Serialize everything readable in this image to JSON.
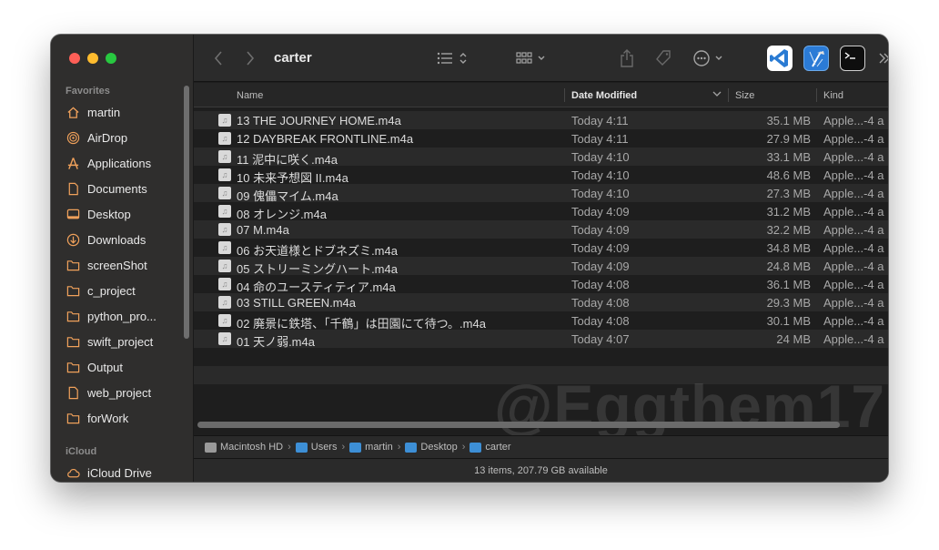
{
  "window": {
    "title": "carter"
  },
  "sidebar": {
    "favorites_title": "Favorites",
    "items": [
      {
        "label": "martin",
        "icon": "home-icon"
      },
      {
        "label": "AirDrop",
        "icon": "airdrop-icon"
      },
      {
        "label": "Applications",
        "icon": "applications-icon"
      },
      {
        "label": "Documents",
        "icon": "document-icon"
      },
      {
        "label": "Desktop",
        "icon": "desktop-icon"
      },
      {
        "label": "Downloads",
        "icon": "downloads-icon"
      },
      {
        "label": "screenShot",
        "icon": "folder-icon"
      },
      {
        "label": "c_project",
        "icon": "folder-icon"
      },
      {
        "label": "python_pro...",
        "icon": "folder-icon"
      },
      {
        "label": "swift_project",
        "icon": "folder-icon"
      },
      {
        "label": "Output",
        "icon": "folder-icon"
      },
      {
        "label": "web_project",
        "icon": "document-icon"
      },
      {
        "label": "forWork",
        "icon": "folder-icon"
      }
    ],
    "icloud_title": "iCloud",
    "icloud_items": [
      {
        "label": "iCloud Drive",
        "icon": "cloud-icon"
      }
    ]
  },
  "toolbar": {
    "apps": [
      "vscode-icon",
      "xcode-icon",
      "terminal-icon"
    ]
  },
  "columns": {
    "name": "Name",
    "date": "Date Modified",
    "size": "Size",
    "kind": "Kind"
  },
  "files": [
    {
      "name": "13 THE JOURNEY HOME.m4a",
      "date": "Today 4:11",
      "size": "35.1 MB",
      "kind": "Apple...-4 a"
    },
    {
      "name": "12 DAYBREAK FRONTLINE.m4a",
      "date": "Today 4:11",
      "size": "27.9 MB",
      "kind": "Apple...-4 a"
    },
    {
      "name": "11 泥中に咲く.m4a",
      "date": "Today 4:10",
      "size": "33.1 MB",
      "kind": "Apple...-4 a"
    },
    {
      "name": "10 未来予想図 II.m4a",
      "date": "Today 4:10",
      "size": "48.6 MB",
      "kind": "Apple...-4 a"
    },
    {
      "name": "09 傀儡マイム.m4a",
      "date": "Today 4:10",
      "size": "27.3 MB",
      "kind": "Apple...-4 a"
    },
    {
      "name": "08 オレンジ.m4a",
      "date": "Today 4:09",
      "size": "31.2 MB",
      "kind": "Apple...-4 a"
    },
    {
      "name": "07 M.m4a",
      "date": "Today 4:09",
      "size": "32.2 MB",
      "kind": "Apple...-4 a"
    },
    {
      "name": "06 お天道様とドブネズミ.m4a",
      "date": "Today 4:09",
      "size": "34.8 MB",
      "kind": "Apple...-4 a"
    },
    {
      "name": "05 ストリーミングハート.m4a",
      "date": "Today 4:09",
      "size": "24.8 MB",
      "kind": "Apple...-4 a"
    },
    {
      "name": "04 命のユースティティア.m4a",
      "date": "Today 4:08",
      "size": "36.1 MB",
      "kind": "Apple...-4 a"
    },
    {
      "name": "03 STILL GREEN.m4a",
      "date": "Today 4:08",
      "size": "29.3 MB",
      "kind": "Apple...-4 a"
    },
    {
      "name": "02 廃景に鉄塔、「千鶴」は田園にて待つ。.m4a",
      "date": "Today 4:08",
      "size": "30.1 MB",
      "kind": "Apple...-4 a"
    },
    {
      "name": "01 天ノ弱.m4a",
      "date": "Today 4:07",
      "size": "24 MB",
      "kind": "Apple...-4 a"
    }
  ],
  "pathbar": [
    {
      "label": "Macintosh HD",
      "icon": "drive-icon",
      "color": "#9a9a9a"
    },
    {
      "label": "Users",
      "icon": "folder-icon",
      "color": "#3d8fd6"
    },
    {
      "label": "martin",
      "icon": "folder-icon",
      "color": "#3d8fd6"
    },
    {
      "label": "Desktop",
      "icon": "folder-icon",
      "color": "#3d8fd6"
    },
    {
      "label": "carter",
      "icon": "folder-icon",
      "color": "#3d8fd6"
    }
  ],
  "status": "13 items, 207.79 GB available",
  "watermark": "@Eggthem17",
  "colors": {
    "close": "#fe5f57",
    "minimize": "#febc2e",
    "maximize": "#28c840",
    "sidebar_icon": "#f0a15b"
  }
}
